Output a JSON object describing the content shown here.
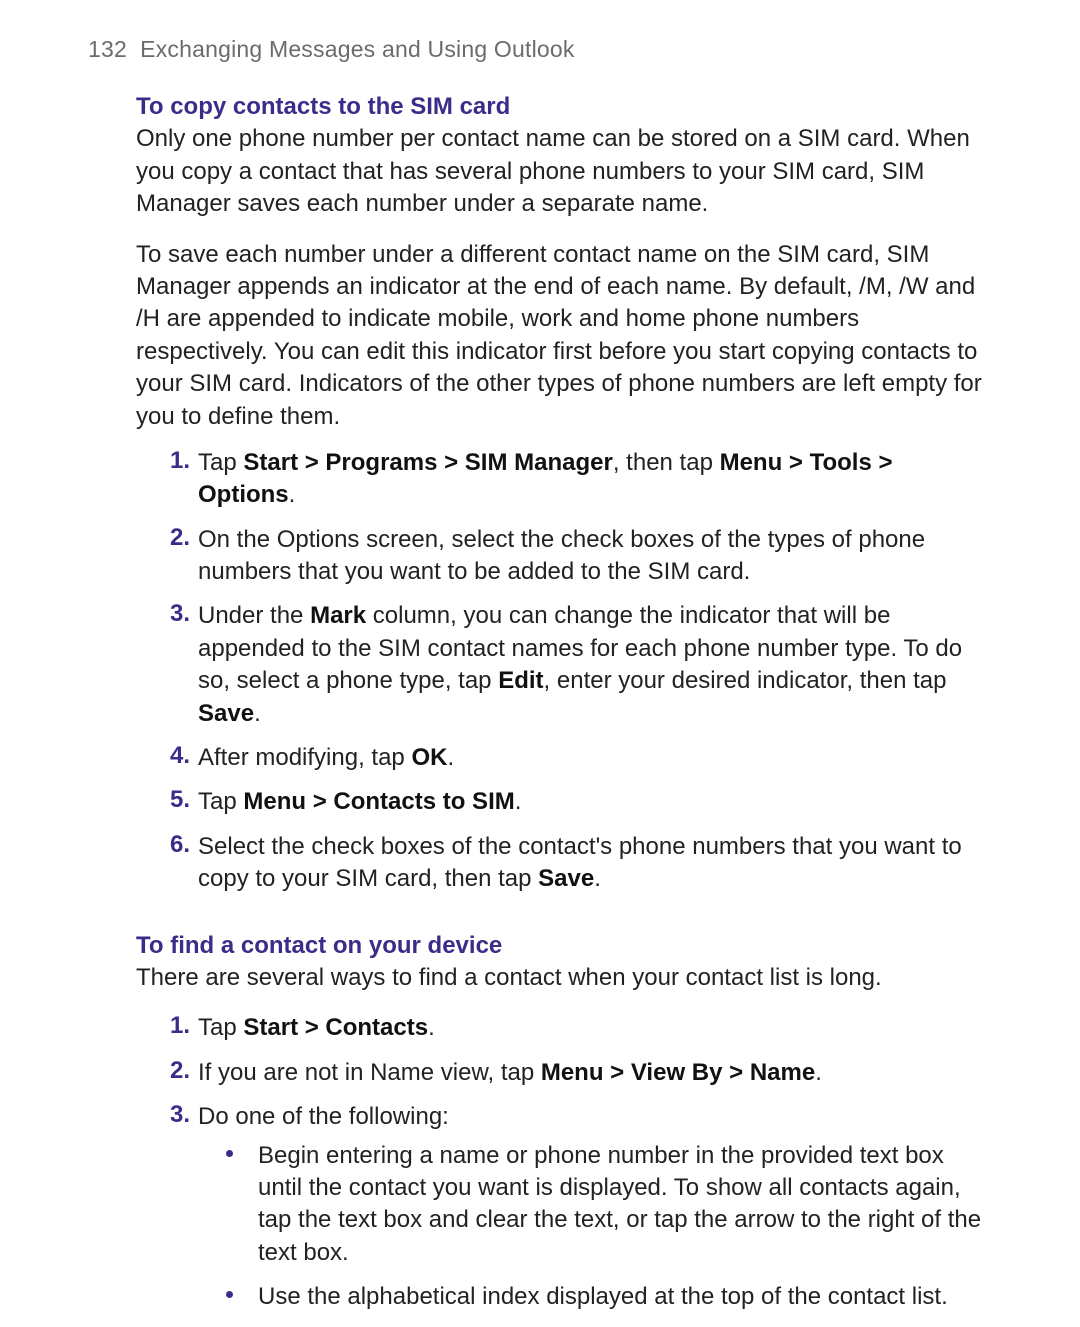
{
  "header": {
    "page_number": "132",
    "chapter_title": "Exchanging Messages and Using Outlook"
  },
  "section1": {
    "heading": "To copy contacts to the SIM card",
    "p1": "Only one phone number per contact name can be stored on a SIM card. When you copy a contact that has several phone numbers to your SIM card, SIM Manager saves each number under a separate name.",
    "p2": "To save each number under a different contact name on the SIM card, SIM Manager appends an indicator at the end of each name. By default, /M, /W and /H are appended to indicate mobile, work and home phone numbers respectively. You can edit this indicator first before you start copying contacts to your SIM card. Indicators of the other types of phone numbers are left empty for you to define them.",
    "steps": {
      "s1": {
        "t1": "Tap ",
        "b1": "Start > Programs > SIM Manager",
        "t2": ", then tap ",
        "b2": "Menu > Tools > Options",
        "t3": "."
      },
      "s2": "On the Options screen, select the check boxes of the types of phone numbers that you want to be added to the SIM card.",
      "s3": {
        "t1": "Under the ",
        "b1": "Mark",
        "t2": " column, you can change the indicator that will be appended to the SIM contact names for each phone number type. To do so, select a phone type, tap ",
        "b2": "Edit",
        "t3": ", enter your desired indicator, then tap ",
        "b3": "Save",
        "t4": "."
      },
      "s4": {
        "t1": "After modifying, tap ",
        "b1": "OK",
        "t2": "."
      },
      "s5": {
        "t1": "Tap ",
        "b1": "Menu > Contacts to SIM",
        "t2": "."
      },
      "s6": {
        "t1": "Select the check boxes of the contact's phone numbers that you want to copy to your SIM card, then tap ",
        "b1": "Save",
        "t2": "."
      }
    }
  },
  "section2": {
    "heading": "To find a contact on your device",
    "p1": "There are several ways to find a contact when your contact list is long.",
    "steps": {
      "s1": {
        "t1": "Tap ",
        "b1": "Start > Contacts",
        "t2": "."
      },
      "s2": {
        "t1": "If you are not in Name view, tap ",
        "b1": "Menu > View By > Name",
        "t2": "."
      },
      "s3": {
        "t1": "Do one of the following:",
        "bullets": {
          "b1": "Begin entering a name or phone number in the provided text box until the contact you want is displayed. To show all contacts again, tap the text box and clear the text, or tap the arrow to the right of the text box.",
          "b2": "Use the alphabetical index displayed at the top of the contact list."
        }
      }
    }
  },
  "markers": {
    "n1": "1.",
    "n2": "2.",
    "n3": "3.",
    "n4": "4.",
    "n5": "5.",
    "n6": "6."
  }
}
